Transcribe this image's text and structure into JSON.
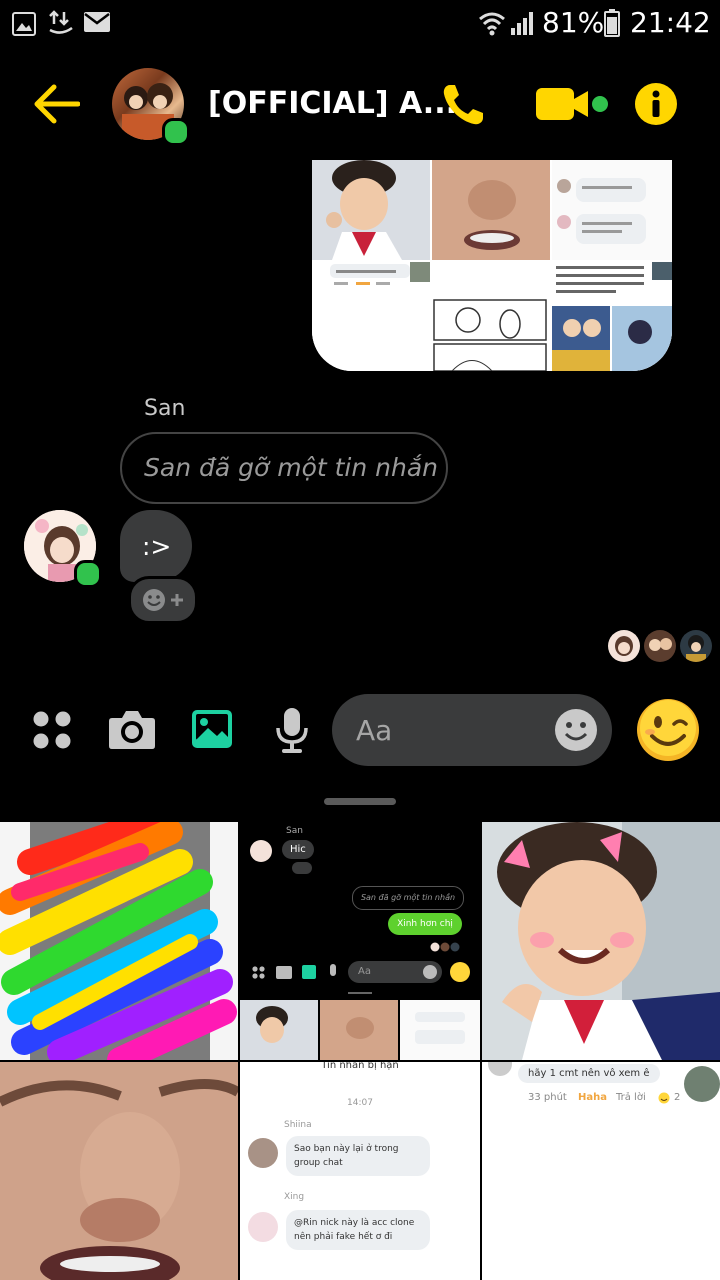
{
  "status_bar": {
    "battery": "81%",
    "time": "21:42"
  },
  "header": {
    "title": "[OFFICIAL] A..."
  },
  "conversation": {
    "sender_name": "San",
    "removed_message": "San đã gỡ một tin nhắn",
    "message": ":>"
  },
  "composer": {
    "placeholder": "Aa"
  },
  "shared_images": {
    "cell4_comment": "hãy 1 cmt nên vô xem ê",
    "cell4_meta": "33 phút",
    "cell4_reaction": "Haha",
    "cell4_reply": "Trả lời"
  },
  "gallery": {
    "cell2": {
      "sender": "San",
      "msg": "Hic",
      "removed": "San đã gỡ một tin nhắn",
      "reply": "Xinh hơn chị",
      "placeholder": "Aa"
    },
    "cell5": {
      "title": "Tin nhắn bị hạn",
      "time": "14:07",
      "user1": "Shiina",
      "msg1": "Sao bạn này lại ở trong group chat",
      "user2": "Xing",
      "msg2": "@Rin nick này là acc clone nên phải fake hết ơ đi"
    },
    "cell6": {
      "comment": "hãy 1 cmt nên vô xem ê",
      "meta": "33 phút",
      "reaction": "Haha",
      "reply": "Trả lời",
      "count": "2"
    }
  },
  "colors": {
    "accent": "#FFD600",
    "online": "#31C24D",
    "teal": "#1DD1A1"
  }
}
